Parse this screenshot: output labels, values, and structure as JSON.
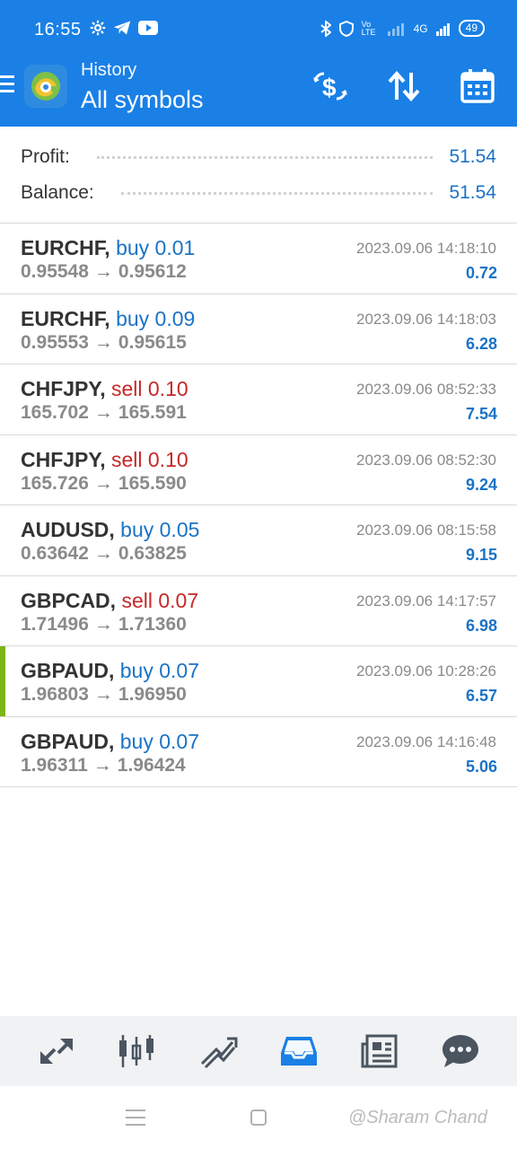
{
  "status_bar": {
    "time": "16:55",
    "network": "4G",
    "volte": "Vo LTE",
    "battery": "49"
  },
  "header": {
    "subtitle": "History",
    "title": "All symbols"
  },
  "summary": {
    "profit_label": "Profit:",
    "profit_value": "51.54",
    "balance_label": "Balance:",
    "balance_value": "51.54"
  },
  "trades": [
    {
      "symbol": "EURCHF,",
      "direction": "buy 0.01",
      "type": "buy",
      "open": "0.95548",
      "close": "0.95612",
      "time": "2023.09.06 14:18:10",
      "profit": "0.72"
    },
    {
      "symbol": "EURCHF,",
      "direction": "buy 0.09",
      "type": "buy",
      "open": "0.95553",
      "close": "0.95615",
      "time": "2023.09.06 14:18:03",
      "profit": "6.28"
    },
    {
      "symbol": "CHFJPY,",
      "direction": "sell 0.10",
      "type": "sell",
      "open": "165.702",
      "close": "165.591",
      "time": "2023.09.06 08:52:33",
      "profit": "7.54"
    },
    {
      "symbol": "CHFJPY,",
      "direction": "sell 0.10",
      "type": "sell",
      "open": "165.726",
      "close": "165.590",
      "time": "2023.09.06 08:52:30",
      "profit": "9.24"
    },
    {
      "symbol": "AUDUSD,",
      "direction": "buy 0.05",
      "type": "buy",
      "open": "0.63642",
      "close": "0.63825",
      "time": "2023.09.06 08:15:58",
      "profit": "9.15"
    },
    {
      "symbol": "GBPCAD,",
      "direction": "sell 0.07",
      "type": "sell",
      "open": "1.71496",
      "close": "1.71360",
      "time": "2023.09.06 14:17:57",
      "profit": "6.98"
    },
    {
      "symbol": "GBPAUD,",
      "direction": "buy 0.07",
      "type": "buy",
      "open": "1.96803",
      "close": "1.96950",
      "time": "2023.09.06 10:28:26",
      "profit": "6.57"
    },
    {
      "symbol": "GBPAUD,",
      "direction": "buy 0.07",
      "type": "buy",
      "open": "1.96311",
      "close": "1.96424",
      "time": "2023.09.06 14:16:48",
      "profit": "5.06"
    }
  ],
  "arrow": "→",
  "bottom_nav": [
    "quotes-icon",
    "chart-icon",
    "trade-icon",
    "history-icon",
    "news-icon",
    "messages-icon"
  ],
  "watermark": "@Sharam Chand",
  "colors": {
    "accent": "#1a80e6",
    "buy": "#1a73c7",
    "sell": "#c62828",
    "marker": "#7cb518"
  }
}
